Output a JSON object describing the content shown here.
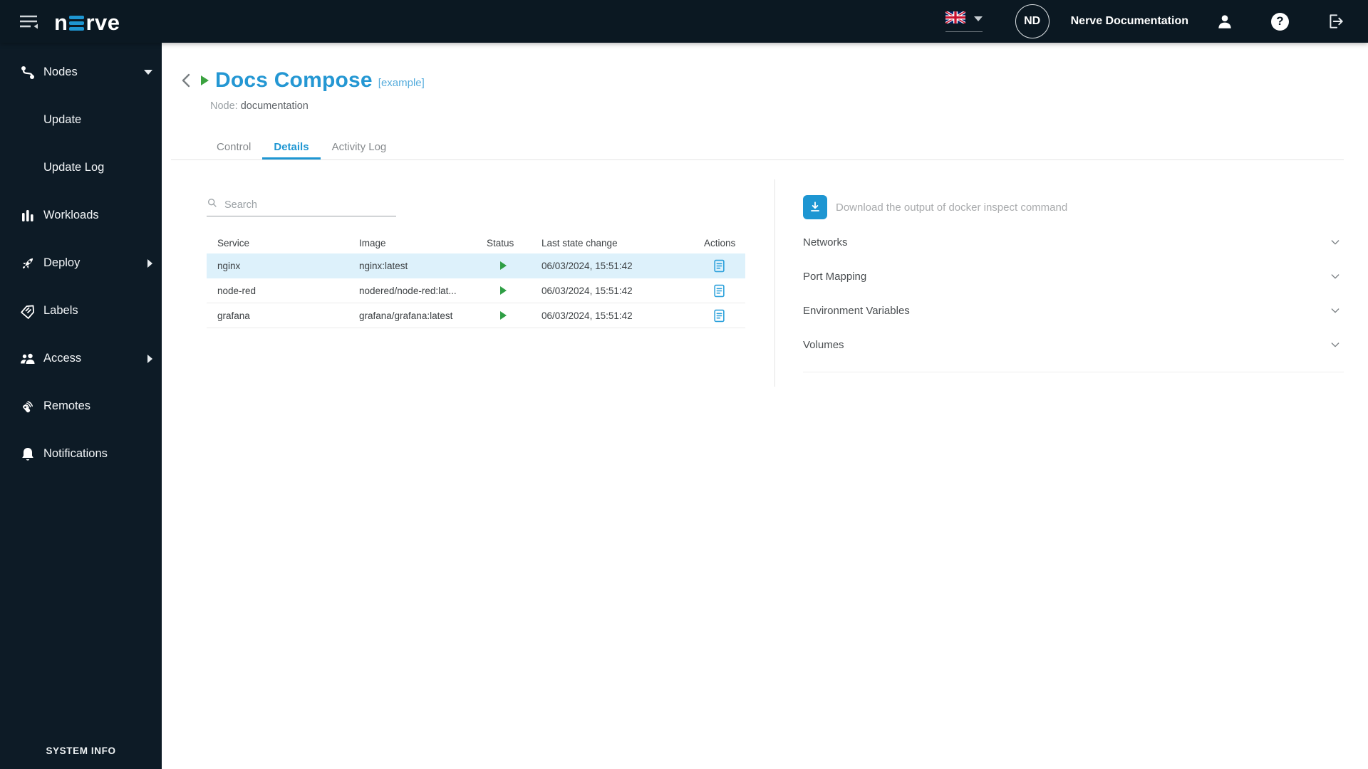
{
  "topbar": {
    "logo": {
      "part1": "n",
      "part2": "rve"
    },
    "language": "en-GB",
    "account_initials": "ND",
    "account_name": "Nerve Documentation",
    "help_glyph": "?"
  },
  "sidebar": {
    "items": [
      {
        "label": "Nodes"
      },
      {
        "label": "Update"
      },
      {
        "label": "Update Log"
      },
      {
        "label": "Workloads"
      },
      {
        "label": "Deploy"
      },
      {
        "label": "Labels"
      },
      {
        "label": "Access"
      },
      {
        "label": "Remotes"
      },
      {
        "label": "Notifications"
      }
    ],
    "footer": "SYSTEM INFO"
  },
  "header": {
    "title": "Docs Compose",
    "badge": "[example]",
    "node_label": "Node:",
    "node_value": "documentation"
  },
  "tabs": [
    {
      "label": "Control"
    },
    {
      "label": "Details"
    },
    {
      "label": "Activity Log"
    }
  ],
  "search": {
    "placeholder": "Search"
  },
  "table": {
    "columns": [
      "Service",
      "Image",
      "Status",
      "Last state change",
      "Actions"
    ],
    "rows": [
      {
        "service": "nginx",
        "image": "nginx:latest",
        "status": "running",
        "last_state_change": "06/03/2024, 15:51:42"
      },
      {
        "service": "node-red",
        "image": "nodered/node-red:lat...",
        "status": "running",
        "last_state_change": "06/03/2024, 15:51:42"
      },
      {
        "service": "grafana",
        "image": "grafana/grafana:latest",
        "status": "running",
        "last_state_change": "06/03/2024, 15:51:42"
      }
    ]
  },
  "inspect": {
    "download_label": "Download the output of docker inspect command",
    "sections": [
      {
        "label": "Networks"
      },
      {
        "label": "Port Mapping"
      },
      {
        "label": "Environment Variables"
      },
      {
        "label": "Volumes"
      }
    ]
  },
  "colors": {
    "accent": "#1e96d2",
    "dark": "#0d1b26",
    "green": "#2e9e44",
    "row_highlight": "#ddf1fb"
  }
}
